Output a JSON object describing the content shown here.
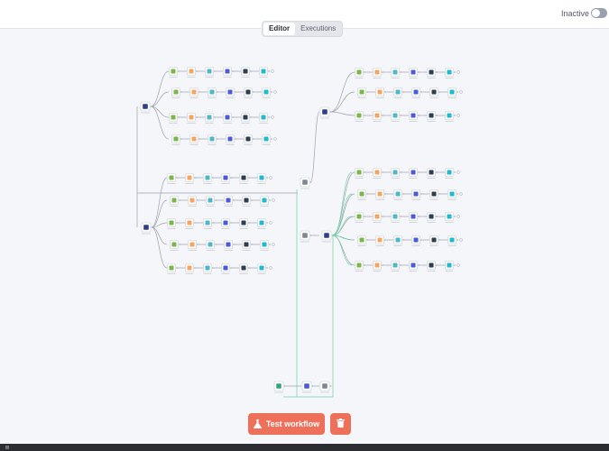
{
  "header": {
    "status_label": "Inactive",
    "active": false
  },
  "tabs": [
    {
      "label": "Editor",
      "active": true
    },
    {
      "label": "Executions",
      "active": false
    }
  ],
  "actions": {
    "test_label": "Test workflow"
  },
  "colors": {
    "accent": "#ee6f5a",
    "connection": "#9aa1ad",
    "connection_active": "#71d1a8",
    "node_border": "#c9ccd4",
    "green": "#7ab648",
    "orange": "#f4a661",
    "teal": "#4fb7c7",
    "indigo": "#4b5bd7",
    "navy": "#2c3e50",
    "cyan": "#22b8cf"
  },
  "workflow": {
    "groups": [
      {
        "name": "group-top-left",
        "branches": 4,
        "icons": [
          "green",
          "orange",
          "teal",
          "indigo",
          "navy",
          "cyan"
        ]
      },
      {
        "name": "group-mid-left",
        "branches": 5,
        "icons": [
          "green",
          "orange",
          "teal",
          "indigo",
          "navy",
          "cyan"
        ]
      },
      {
        "name": "group-top-right",
        "branches": 3,
        "icons": [
          "green",
          "orange",
          "teal",
          "indigo",
          "navy",
          "cyan"
        ]
      },
      {
        "name": "group-mid-right",
        "branches": 5,
        "icons": [
          "green",
          "orange",
          "teal",
          "indigo",
          "navy",
          "cyan"
        ]
      }
    ]
  }
}
